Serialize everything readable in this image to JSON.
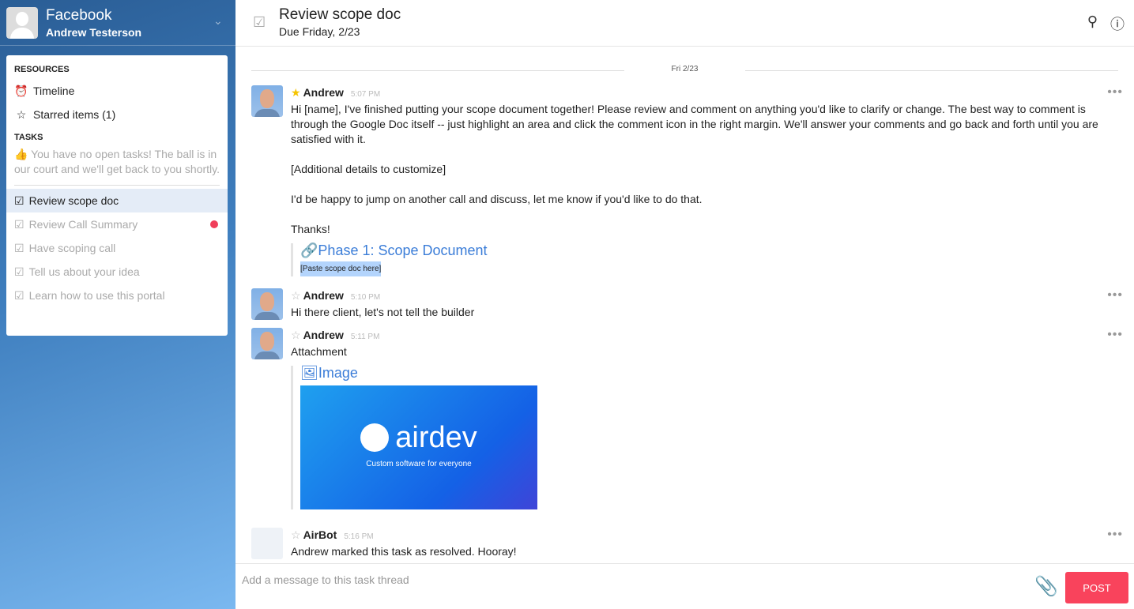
{
  "sidebar": {
    "org": "Facebook",
    "user": "Andrew Testerson",
    "resources_label": "RESOURCES",
    "timeline": "Timeline",
    "starred": "Starred items (1)",
    "tasks_label": "TASKS",
    "empty": "You have no open tasks! The ball is in our court and we'll get back to you shortly.",
    "tasks": [
      {
        "label": "Review scope doc"
      },
      {
        "label": "Review Call Summary"
      },
      {
        "label": "Have scoping call"
      },
      {
        "label": "Tell us about your idea"
      },
      {
        "label": "Learn how to use this portal"
      }
    ]
  },
  "header": {
    "title": "Review scope doc",
    "due": "Due Friday, 2/23"
  },
  "thread": {
    "date": "Fri 2/23",
    "messages": [
      {
        "name": "Andrew",
        "time": "5:07 PM",
        "p1": "Hi [name], I've finished putting your scope document together!  Please review and comment on anything you'd like to clarify or change. The best way to comment is through the Google Doc itself -- just highlight an area and click the comment icon in the right margin. We'll answer your comments and go back and forth until you are satisfied with it.",
        "p2": "[Additional details to customize]",
        "p3": "I'd be happy to jump on another call and discuss, let me know if you'd like to do that.",
        "p4": "Thanks!",
        "link": "Phase 1: Scope Document",
        "link_sub": "[Paste scope doc here]"
      },
      {
        "name": "Andrew",
        "time": "5:10 PM",
        "text": "Hi there client, let's not tell the builder"
      },
      {
        "name": "Andrew",
        "time": "5:11 PM",
        "text": "Attachment",
        "link": "Image",
        "img_logo": "airdev",
        "img_tag": "Custom software for everyone"
      },
      {
        "name": "AirBot",
        "time": "5:16 PM",
        "text": "Andrew marked this task as resolved. Hooray!"
      }
    ]
  },
  "composer": {
    "placeholder": "Add a message to this task thread",
    "post": "POST"
  }
}
